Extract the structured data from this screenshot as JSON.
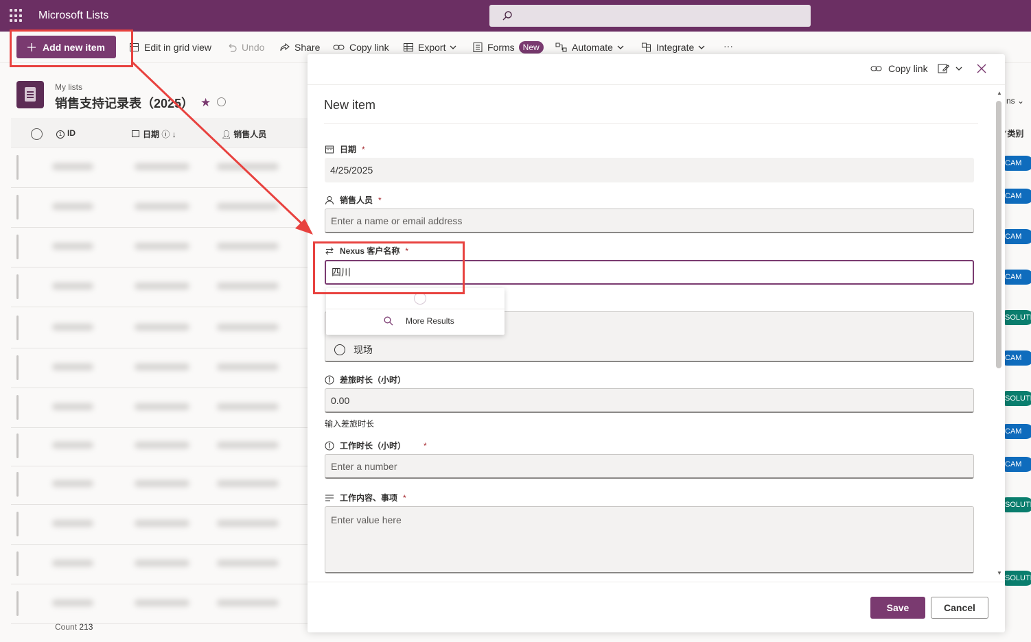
{
  "app": {
    "title": "Microsoft Lists"
  },
  "toolbar": {
    "add_new_item": "Add new item",
    "edit_grid": "Edit in grid view",
    "undo": "Undo",
    "share": "Share",
    "copy_link": "Copy link",
    "export": "Export",
    "forms": "Forms",
    "forms_badge": "New",
    "automate": "Automate",
    "integrate": "Integrate",
    "more": "···"
  },
  "list": {
    "breadcrumb": "My lists",
    "title": "销售支持记录表（2025）",
    "columns": {
      "id": "ID",
      "date": "日期",
      "sales": "销售人员",
      "category": "类别",
      "partial_right": "ns"
    },
    "count_label": "Count",
    "count_value": "213",
    "tags": [
      "CAM",
      "CAM",
      "CAM",
      "CAM",
      "SOLUTIO",
      "CAM",
      "SOLUTIO",
      "CAM",
      "CAM",
      "SOLUTIO",
      "SOLUTIO"
    ]
  },
  "panel": {
    "copy_link": "Copy link",
    "title": "New item",
    "fields": {
      "date": {
        "label": "日期",
        "value": "4/25/2025"
      },
      "sales": {
        "label": "销售人员",
        "placeholder": "Enter a name or email address"
      },
      "customer": {
        "label": "Nexus 客户名称",
        "value": "四川"
      },
      "onsite": {
        "option": "现场"
      },
      "travel": {
        "label": "差旅时长（小时）",
        "value": "0.00",
        "hint": "输入差旅时长"
      },
      "work": {
        "label": "工作时长（小时）",
        "placeholder": "Enter a number"
      },
      "content": {
        "label": "工作内容、事项",
        "placeholder": "Enter value here"
      }
    },
    "dropdown": {
      "more_results": "More Results"
    },
    "save": "Save",
    "cancel": "Cancel",
    "required_mark": "*"
  },
  "colors": {
    "brand": "#6b2f63",
    "accent": "#7a3a70",
    "highlight": "#e8423f"
  }
}
